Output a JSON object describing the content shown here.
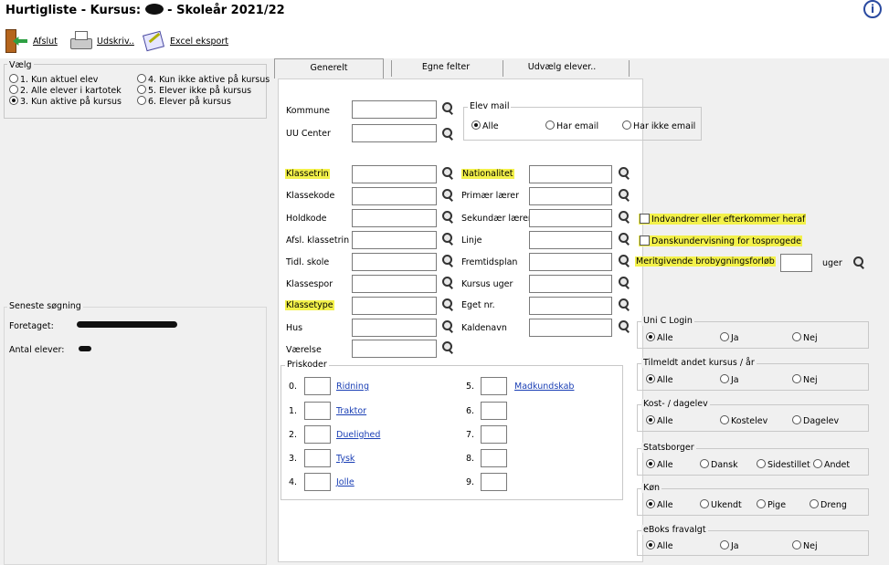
{
  "title": {
    "prefix": "Hurtigliste - Kursus:",
    "suffix": "- Skoleår 2021/22"
  },
  "toolbar": {
    "exit": "Afslut",
    "print": "Udskriv..",
    "excel": "Excel eksport"
  },
  "choose": {
    "legend": "Vælg",
    "options": [
      "1. Kun aktuel elev",
      "2. Alle elever i kartotek",
      "3. Kun aktive på kursus",
      "4. Kun ikke aktive på kursus",
      "5. Elever ikke på kursus",
      "6. Elever på kursus"
    ],
    "selected": 3
  },
  "last_search": {
    "legend": "Seneste søgning",
    "done_label": "Foretaget:",
    "count_label": "Antal elever:"
  },
  "tabs": [
    "Generelt",
    "Egne felter",
    "Udvælg elever.."
  ],
  "fields": {
    "kommune": "Kommune",
    "uu_center": "UU Center",
    "elev_mail": {
      "legend": "Elev mail",
      "options": [
        "Alle",
        "Har email",
        "Har ikke email"
      ]
    },
    "left_col": [
      "Klassetrin",
      "Klassekode",
      "Holdkode",
      "Afsl. klassetrin",
      "Tidl. skole",
      "Klassespor",
      "Klassetype",
      "Hus",
      "Værelse"
    ],
    "mid_col": [
      "Nationalitet",
      "Primær lærer",
      "Sekundær lærer",
      "Linje",
      "Fremtidsplan",
      "Kursus uger",
      "Eget nr.",
      "Kaldenavn"
    ],
    "check1": "Indvandrer eller efterkommer heraf",
    "check2": "Danskundervisning for tosprogede",
    "meritgivende": "Meritgivende brobygningsforløb",
    "uger": "uger"
  },
  "priskoder": {
    "legend": "Priskoder",
    "items": [
      {
        "n": "0.",
        "link": "Ridning"
      },
      {
        "n": "1.",
        "link": "Traktor"
      },
      {
        "n": "2.",
        "link": "Duelighed"
      },
      {
        "n": "3.",
        "link": "Tysk"
      },
      {
        "n": "4.",
        "link": "Jolle"
      },
      {
        "n": "5.",
        "link": "Madkundskab"
      },
      {
        "n": "6.",
        "link": ""
      },
      {
        "n": "7.",
        "link": ""
      },
      {
        "n": "8.",
        "link": ""
      },
      {
        "n": "9.",
        "link": ""
      }
    ]
  },
  "right_groups": {
    "unic": {
      "legend": "Uni C Login",
      "opts": [
        "Alle",
        "Ja",
        "Nej"
      ]
    },
    "tilmeldt": {
      "legend": "Tilmeldt andet kursus / år",
      "opts": [
        "Alle",
        "Ja",
        "Nej"
      ]
    },
    "kost": {
      "legend": "Kost- / dagelev",
      "opts": [
        "Alle",
        "Kostelev",
        "Dagelev"
      ]
    },
    "stats": {
      "legend": "Statsborger",
      "opts": [
        "Alle",
        "Dansk",
        "Sidestillet",
        "Andet"
      ]
    },
    "koen": {
      "legend": "Køn",
      "opts": [
        "Alle",
        "Ukendt",
        "Pige",
        "Dreng"
      ]
    },
    "eboks": {
      "legend": "eBoks fravalgt",
      "opts": [
        "Alle",
        "Ja",
        "Nej"
      ]
    }
  },
  "colors": {
    "highlight": "#f3f14a",
    "link": "#1a3fb5"
  }
}
